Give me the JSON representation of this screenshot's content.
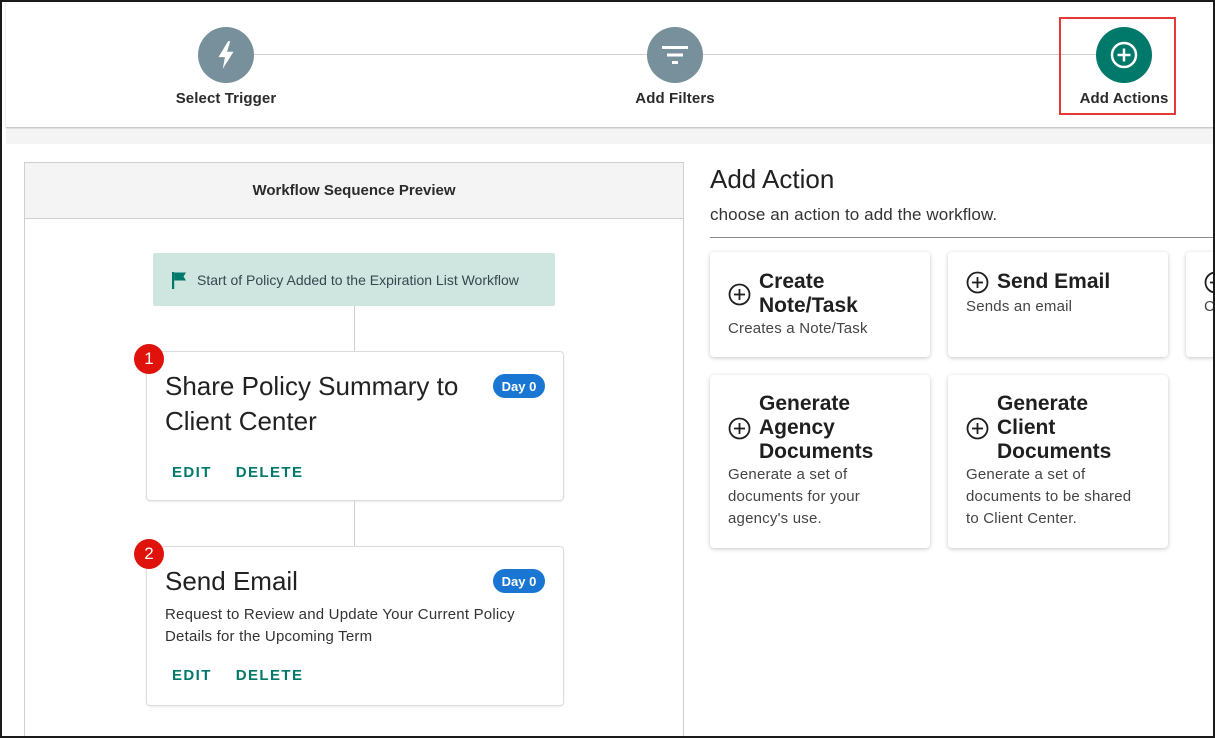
{
  "stepper": {
    "steps": [
      {
        "label": "Select Trigger",
        "icon": "lightning-icon"
      },
      {
        "label": "Add Filters",
        "icon": "filter-icon"
      },
      {
        "label": "Add Actions",
        "icon": "add-circle-icon"
      }
    ],
    "active_color": "#00796b",
    "inactive_color": "#78909c"
  },
  "preview": {
    "header": "Workflow Sequence Preview",
    "start_banner": "Start of Policy Added to the Expiration List Workflow",
    "steps": [
      {
        "number": "1",
        "title_line1": "Share Policy Summary to",
        "title_line2": "Client Center",
        "day_badge": "Day 0",
        "edit_label": "EDIT",
        "delete_label": "DELETE"
      },
      {
        "number": "2",
        "title_line1": "Send Email",
        "day_badge": "Day 0",
        "desc_line1": "Request to Review and Update Your Current Policy",
        "desc_line2": "Details for the Upcoming Term",
        "edit_label": "EDIT",
        "delete_label": "DELETE"
      }
    ]
  },
  "add_action": {
    "title": "Add Action",
    "subtitle": "choose an action to add the workflow.",
    "cards": [
      {
        "title_lines": [
          "Create",
          "Note/Task"
        ],
        "desc_lines": [
          "Creates a Note/Task"
        ]
      },
      {
        "title_lines": [
          "Send Email"
        ],
        "desc_lines": [
          "Sends an email"
        ]
      },
      {
        "title_lines": [
          ""
        ],
        "desc_lines": [
          "C"
        ]
      },
      {
        "title_lines": [
          "Generate",
          "Agency",
          "Documents"
        ],
        "desc_lines": [
          "Generate a set of",
          "documents for your",
          "agency's use."
        ]
      },
      {
        "title_lines": [
          "Generate",
          "Client",
          "Documents"
        ],
        "desc_lines": [
          "Generate a set of",
          "documents to be shared",
          "to Client Center."
        ]
      }
    ]
  },
  "colors": {
    "accent": "#00796b",
    "badge": "#1976d2",
    "step_number": "#e0120c",
    "highlight_border": "#e53935",
    "start_banner_bg": "#cfe5e0"
  }
}
